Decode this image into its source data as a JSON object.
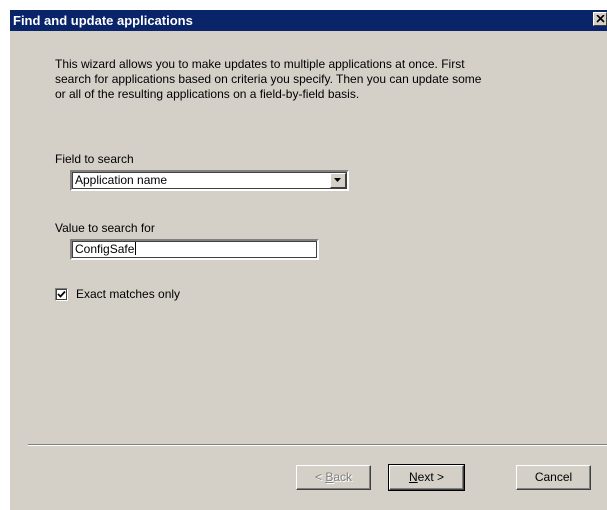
{
  "window": {
    "title": "Find and update applications",
    "close_glyph": "×"
  },
  "intro": {
    "line1": "This wizard allows you to make updates to multiple applications at once.  First",
    "line2": "search for applications based on criteria you specify.  Then you can update some",
    "line3": "or all of the resulting applications on a field-by-field basis."
  },
  "field_to_search": {
    "label": "Field to search",
    "selected": "Application name"
  },
  "value_to_search": {
    "label": "Value to search for",
    "value": "ConfigSafe"
  },
  "exact_match": {
    "label": "Exact matches only",
    "checked": true
  },
  "buttons": {
    "back_arrow": "< ",
    "back_mnemonic": "B",
    "back_rest": "ack",
    "next_mnemonic": "N",
    "next_rest": "ext >",
    "cancel": "Cancel"
  },
  "colors": {
    "titlebar": "#0a246a",
    "dialog_face": "#d4d0c8",
    "disabled_text": "#808080"
  }
}
